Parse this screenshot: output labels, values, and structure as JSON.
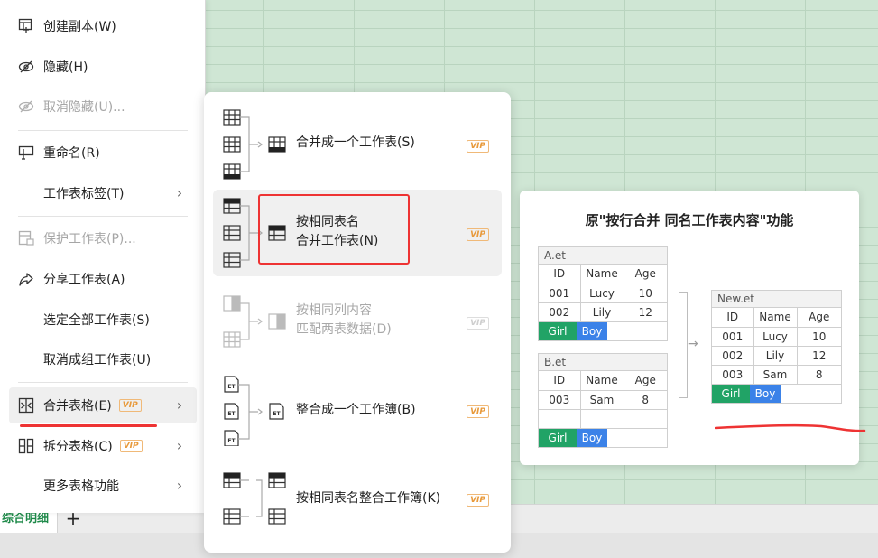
{
  "menu": {
    "items": [
      {
        "label": "创建副本(W)",
        "icon": "copy-sheet-icon"
      },
      {
        "label": "隐藏(H)",
        "icon": "hide-icon"
      },
      {
        "label": "取消隐藏(U)...",
        "icon": "unhide-icon",
        "disabled": true
      },
      {
        "label": "重命名(R)",
        "icon": "rename-icon"
      },
      {
        "label": "工作表标签(T)",
        "icon": ""
      },
      {
        "label": "保护工作表(P)...",
        "icon": "protect-sheet-icon",
        "disabled": true
      },
      {
        "label": "分享工作表(A)",
        "icon": "share-icon"
      },
      {
        "label": "选定全部工作表(S)",
        "icon": ""
      },
      {
        "label": "取消成组工作表(U)",
        "icon": ""
      },
      {
        "label": "合并表格(E)",
        "icon": "merge-tables-icon",
        "vip": "VIP"
      },
      {
        "label": "拆分表格(C)",
        "icon": "split-tables-icon",
        "vip": "VIP"
      },
      {
        "label": "更多表格功能",
        "icon": ""
      }
    ]
  },
  "submenu": {
    "items": [
      {
        "label": "合并成一个工作表(S)",
        "vip": "VIP"
      },
      {
        "label_line1": "按相同表名",
        "label_line2": "合并工作表(N)",
        "vip": "VIP"
      },
      {
        "label_line1": "按相同列内容",
        "label_line2": "匹配两表数据(D)",
        "vip": "VIP",
        "disabled": true
      },
      {
        "label": "整合成一个工作簿(B)",
        "vip": "VIP"
      },
      {
        "label": "按相同表名整合工作簿(K)",
        "vip": "VIP"
      }
    ],
    "et_label": "ET"
  },
  "preview": {
    "title": "原\"按行合并 同名工作表内容\"功能",
    "table_a": {
      "name": "A.et",
      "headers": [
        "ID",
        "Name",
        "Age"
      ],
      "rows": [
        [
          "001",
          "Lucy",
          "10"
        ],
        [
          "002",
          "Lily",
          "12"
        ]
      ],
      "tags": [
        "Girl",
        "Boy"
      ]
    },
    "table_b": {
      "name": "B.et",
      "headers": [
        "ID",
        "Name",
        "Age"
      ],
      "rows": [
        [
          "003",
          "Sam",
          "8"
        ],
        [
          "",
          "",
          ""
        ]
      ],
      "tags": [
        "Girl",
        "Boy"
      ]
    },
    "table_new": {
      "name": "New.et",
      "headers": [
        "ID",
        "Name",
        "Age"
      ],
      "rows": [
        [
          "001",
          "Lucy",
          "10"
        ],
        [
          "002",
          "Lily",
          "12"
        ],
        [
          "003",
          "Sam",
          "8"
        ]
      ],
      "tags": [
        "Girl",
        "Boy"
      ]
    }
  },
  "tabbar": {
    "sheet_name": "综合明细",
    "add_label": "+"
  },
  "colors": {
    "accent_red": "#e33333",
    "vip_orange": "#e89a3c",
    "tag_green": "#21a366",
    "tag_blue": "#3b82e8",
    "sheet_green": "#cfe6d4"
  }
}
